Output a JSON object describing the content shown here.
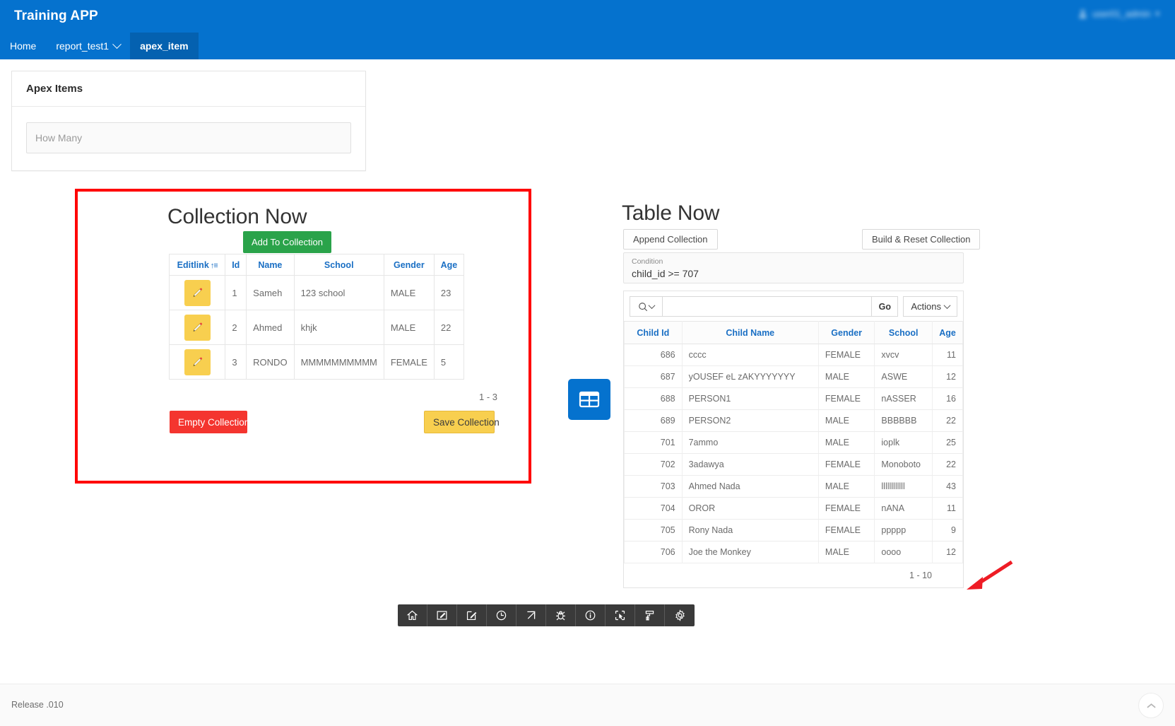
{
  "header": {
    "app_title": "Training APP",
    "user": {
      "name": "user01_admin",
      "caret": "▾"
    },
    "nav": [
      {
        "label": "Home",
        "active": false,
        "has_caret": false
      },
      {
        "label": "report_test1",
        "active": false,
        "has_caret": true
      },
      {
        "label": "apex_item",
        "active": true,
        "has_caret": false
      }
    ]
  },
  "apex_card": {
    "title": "Apex Items",
    "how_many_placeholder": "How Many",
    "how_many_value": ""
  },
  "collection": {
    "title": "Collection Now",
    "add_button": "Add To Collection",
    "empty_button": "Empty Collection",
    "save_button": "Save Collection",
    "row_count": "1 - 3",
    "columns": [
      "Editlink",
      "Id",
      "Name",
      "School",
      "Gender",
      "Age"
    ],
    "sort_glyph": "↑≡",
    "rows": [
      {
        "id": "1",
        "name": "Sameh",
        "school": "123 school",
        "gender": "MALE",
        "age": "23"
      },
      {
        "id": "2",
        "name": "Ahmed",
        "school": "khjk",
        "gender": "MALE",
        "age": "22"
      },
      {
        "id": "3",
        "name": "RONDO",
        "school": "MMMMMMMMMM",
        "gender": "FEMALE",
        "age": "5"
      }
    ]
  },
  "table_now": {
    "title": "Table Now",
    "append_button": "Append Collection",
    "build_button": "Build & Reset Collection",
    "condition_label": "Condition",
    "condition_value": "child_id >= 707",
    "search_placeholder": "",
    "search_value": "",
    "go_button": "Go",
    "actions_button": "Actions",
    "row_count": "1 - 10",
    "columns": [
      "Child Id",
      "Child Name",
      "Gender",
      "School",
      "Age"
    ],
    "rows": [
      {
        "child_id": "686",
        "child_name": "cccc",
        "gender": "FEMALE",
        "school": "xvcv",
        "age": "11"
      },
      {
        "child_id": "687",
        "child_name": "yOUSEF eL zAKYYYYYYY",
        "gender": "MALE",
        "school": "ASWE",
        "age": "12"
      },
      {
        "child_id": "688",
        "child_name": "PERSON1",
        "gender": "FEMALE",
        "school": "nASSER",
        "age": "16"
      },
      {
        "child_id": "689",
        "child_name": "PERSON2",
        "gender": "MALE",
        "school": "BBBBBB",
        "age": "22"
      },
      {
        "child_id": "701",
        "child_name": "7ammo",
        "gender": "MALE",
        "school": "ioplk",
        "age": "25"
      },
      {
        "child_id": "702",
        "child_name": "3adawya",
        "gender": "FEMALE",
        "school": "Monoboto",
        "age": "22"
      },
      {
        "child_id": "703",
        "child_name": "Ahmed Nada",
        "gender": "MALE",
        "school": "llllllllllll",
        "age": "43"
      },
      {
        "child_id": "704",
        "child_name": "OROR",
        "gender": "FEMALE",
        "school": "nANA",
        "age": "11"
      },
      {
        "child_id": "705",
        "child_name": "Rony Nada",
        "gender": "FEMALE",
        "school": "ppppp",
        "age": "9"
      },
      {
        "child_id": "706",
        "child_name": "Joe the Monkey",
        "gender": "MALE",
        "school": "oooo",
        "age": "12"
      }
    ]
  },
  "dev_toolbar": {
    "items": [
      {
        "icon": "home-icon"
      },
      {
        "icon": "edit-page-icon"
      },
      {
        "icon": "edit-pencil-icon"
      },
      {
        "icon": "clock-icon"
      },
      {
        "icon": "expand-icon"
      },
      {
        "icon": "bug-icon"
      },
      {
        "icon": "info-icon"
      },
      {
        "icon": "select-element-icon"
      },
      {
        "icon": "theme-roller-icon"
      },
      {
        "icon": "gear-icon"
      }
    ]
  },
  "footer": {
    "release": "Release .010"
  },
  "colors": {
    "brand_blue": "#0572ce",
    "nav_active_blue": "#0461b0",
    "green": "#2aa34a",
    "red": "#f4352f",
    "yellow": "#f8cf4f",
    "highlight_red": "#ff0000",
    "link_blue": "#1a6fc4"
  }
}
